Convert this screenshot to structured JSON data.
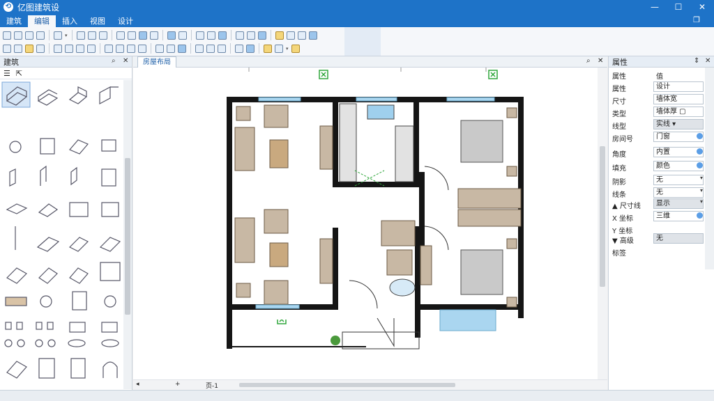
{
  "app": {
    "title": "亿图建筑设"
  },
  "window_controls": {
    "minimize": "—",
    "maximize": "☐",
    "close": "✕"
  },
  "menu": {
    "items": [
      {
        "label": "建筑",
        "active": false
      },
      {
        "label": "编辑",
        "active": true
      },
      {
        "label": "插入",
        "active": false
      },
      {
        "label": "视图",
        "active": false
      },
      {
        "label": "设计",
        "active": false
      }
    ],
    "restore_icon": "❐"
  },
  "library": {
    "title": "建筑",
    "tools": {
      "list_icon": "☰",
      "select_icon": "⇱"
    },
    "header_controls": {
      "search": "⌕",
      "close": "✕"
    }
  },
  "document": {
    "tab_label": "房屋布局",
    "controls": {
      "search": "⌕",
      "close": "✕"
    },
    "bottom_bar": {
      "page_label": "页-1",
      "add_page": "+"
    }
  },
  "properties": {
    "title": "属性",
    "header_controls": {
      "pin": "⇕",
      "close": "✕"
    },
    "column_headers": {
      "name": "属性",
      "value": "值"
    },
    "rows": [
      {
        "label": "属性",
        "value": "设计"
      },
      {
        "label": "尺寸",
        "value": "墙体宽"
      },
      {
        "label": "类型",
        "value": "墙体厚 ▢"
      },
      {
        "label": "线型",
        "value": "实线 ▾",
        "gray": true
      },
      {
        "label": "房间号",
        "value": "门窗"
      },
      {
        "label": "角度",
        "value": "内置"
      },
      {
        "label": "填充",
        "value": "颜色"
      },
      {
        "label": "阴影",
        "value": "无"
      },
      {
        "label": "线条",
        "value": "无"
      },
      {
        "label": "▲ 尺寸线",
        "value": "显示",
        "gray": true
      },
      {
        "label": "X 坐标",
        "value": "三维"
      },
      {
        "label": "Y 坐标",
        "value": ""
      },
      {
        "label": "▼ 高级",
        "value": "无",
        "gray": true
      },
      {
        "label": "标签",
        "value": ""
      }
    ]
  },
  "colors": {
    "accent": "#1e73c8",
    "wall": "#151515",
    "window": "#aad6f0",
    "furniture": "#c8b8a4",
    "bed": "#c9c9c9"
  }
}
